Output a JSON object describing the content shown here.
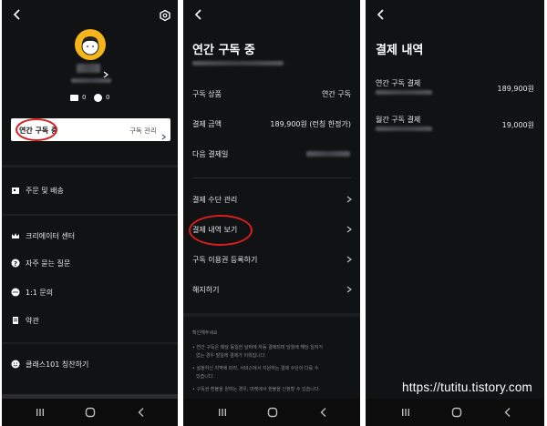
{
  "screen1": {
    "badge_text": "0",
    "badge2_text": "0",
    "subscription_card": {
      "label": "연간 구독 중",
      "manage_label": "구독 관리"
    },
    "menu": [
      {
        "label": "주문 및 배송"
      },
      {
        "label": "크리에이터 센터"
      },
      {
        "label": "자주 묻는 질문"
      },
      {
        "label": "1:1 문의"
      },
      {
        "label": "약관"
      },
      {
        "label": "클래스101 칭찬하기"
      }
    ]
  },
  "screen2": {
    "title": "연간 구독 중",
    "rows": [
      {
        "label": "구독 상품",
        "value": "연간 구독"
      },
      {
        "label": "결제 금액",
        "value": "189,900원 (런칭 한정가)"
      },
      {
        "label": "다음 결제일",
        "value": ""
      }
    ],
    "links": [
      {
        "label": "결제 수단 관리"
      },
      {
        "label": "결제 내역 보기"
      },
      {
        "label": "구독 이용권 등록하기"
      },
      {
        "label": "해지하기"
      }
    ],
    "notice": {
      "title": "확인해주세요",
      "lines": [
        "• 연간 구독은 매달 동일한 날짜에 자동 결제되며 당월에 해당 일자가",
        "없는 경우 말일에 결제가 이뤄집니다.",
        "• 설정하신 지역에 따라, 서비스에서 지원하는 결제 수단이 다를 수",
        "있습니다.",
        "• 구독권 환불을 원하는 경우, 마켓에서 환불을 신청할 수 있습니다."
      ]
    }
  },
  "screen3": {
    "title": "결제 내역",
    "items": [
      {
        "label": "연간 구독 결제",
        "amount": "189,900원"
      },
      {
        "label": "월간 구독 결제",
        "amount": "19,000원"
      }
    ],
    "watermark": "https://tutitu.tistory.com"
  },
  "colors": {
    "background": "#111214",
    "card": "#ffffff",
    "annotation": "#d81e1e",
    "avatar": "#f6b619"
  }
}
